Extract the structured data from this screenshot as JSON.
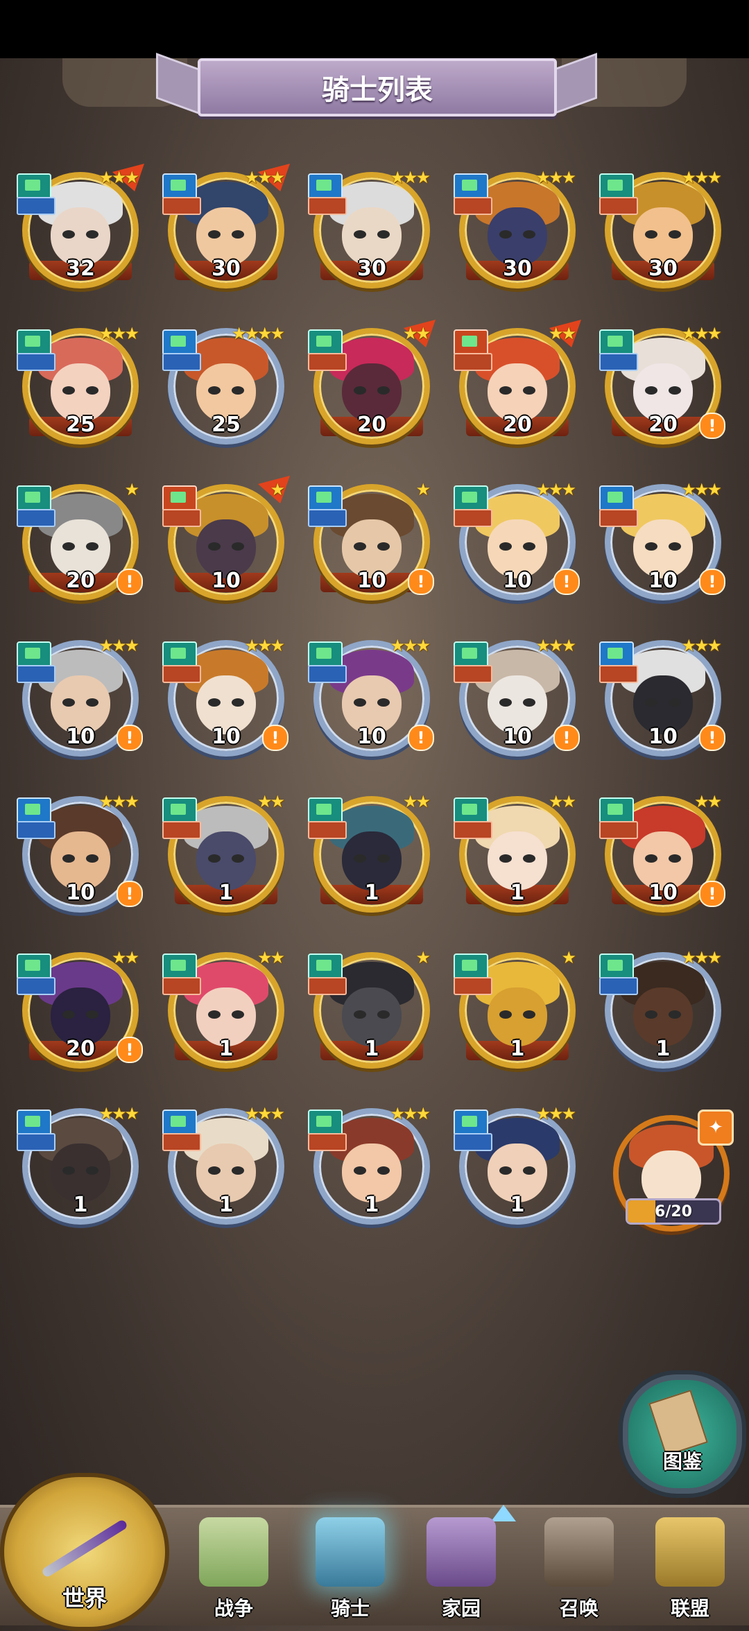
{
  "header": {
    "title": "骑士列表"
  },
  "knights": [
    {
      "level": "32",
      "stars": "★★★",
      "frame": "gold",
      "cls": "teal",
      "role": "blue",
      "flag": true,
      "warn": false,
      "skin": "#e9d6c8",
      "hair": "#e0e0e0"
    },
    {
      "level": "30",
      "stars": "★★★",
      "frame": "gold",
      "cls": "blue",
      "role": "red",
      "flag": true,
      "warn": false,
      "skin": "#f0c8a0",
      "hair": "#32456a"
    },
    {
      "level": "30",
      "stars": "★★★",
      "frame": "gold",
      "cls": "blue",
      "role": "red",
      "flag": false,
      "warn": false,
      "skin": "#ead8c6",
      "hair": "#dcdcdc"
    },
    {
      "level": "30",
      "stars": "★★★",
      "frame": "gold",
      "cls": "blue",
      "role": "red",
      "flag": false,
      "warn": false,
      "skin": "#3a3e6a",
      "hair": "#c8762a"
    },
    {
      "level": "30",
      "stars": "★★★",
      "frame": "gold",
      "cls": "teal",
      "role": "red",
      "flag": false,
      "warn": false,
      "skin": "#f2c08c",
      "hair": "#c8902a"
    },
    {
      "level": "25",
      "stars": "★★★",
      "frame": "gold",
      "cls": "teal",
      "role": "blue",
      "flag": false,
      "warn": false,
      "skin": "#f4d2c0",
      "hair": "#d86a5a"
    },
    {
      "level": "25",
      "stars": "★★★★",
      "frame": "blue",
      "cls": "blue",
      "role": "blue",
      "flag": false,
      "warn": false,
      "skin": "#f2c8a0",
      "hair": "#c8582a"
    },
    {
      "level": "20",
      "stars": "★★",
      "frame": "gold",
      "cls": "teal",
      "role": "red",
      "flag": true,
      "warn": false,
      "skin": "#5a2a3a",
      "hair": "#c82a5a"
    },
    {
      "level": "20",
      "stars": "★★",
      "frame": "gold",
      "cls": "red",
      "role": "red",
      "flag": true,
      "warn": false,
      "skin": "#f6d2b8",
      "hair": "#d8502a"
    },
    {
      "level": "20",
      "stars": "★★★",
      "frame": "gold",
      "cls": "teal",
      "role": "blue",
      "flag": false,
      "warn": true,
      "skin": "#f0e6e6",
      "hair": "#e8e0d8"
    },
    {
      "level": "20",
      "stars": "★",
      "frame": "gold",
      "cls": "teal",
      "role": "blue",
      "flag": false,
      "warn": true,
      "skin": "#e8e2d8",
      "hair": "#888"
    },
    {
      "level": "10",
      "stars": "★",
      "frame": "gold",
      "cls": "red",
      "role": "red",
      "flag": true,
      "warn": false,
      "skin": "#4a3a4a",
      "hair": "#c8902a"
    },
    {
      "level": "10",
      "stars": "★",
      "frame": "gold",
      "cls": "blue",
      "role": "blue",
      "flag": false,
      "warn": true,
      "skin": "#e6c8a8",
      "hair": "#6a4a30"
    },
    {
      "level": "10",
      "stars": "★★★",
      "frame": "blue",
      "cls": "teal",
      "role": "red",
      "flag": false,
      "warn": true,
      "skin": "#f6d8b8",
      "hair": "#f0c860"
    },
    {
      "level": "10",
      "stars": "★★★",
      "frame": "blue",
      "cls": "blue",
      "role": "red",
      "flag": false,
      "warn": true,
      "skin": "#f6dcc0",
      "hair": "#f0c860"
    },
    {
      "level": "10",
      "stars": "★★★",
      "frame": "blue",
      "cls": "teal",
      "role": "blue",
      "flag": false,
      "warn": true,
      "skin": "#e8cab0",
      "hair": "#bcbcbc"
    },
    {
      "level": "10",
      "stars": "★★★",
      "frame": "blue",
      "cls": "teal",
      "role": "red",
      "flag": false,
      "warn": true,
      "skin": "#f0e0d0",
      "hair": "#c87a2a"
    },
    {
      "level": "10",
      "stars": "★★★",
      "frame": "blue",
      "cls": "teal",
      "role": "blue",
      "flag": false,
      "warn": true,
      "skin": "#e8cab0",
      "hair": "#7a3a8a"
    },
    {
      "level": "10",
      "stars": "★★★",
      "frame": "blue",
      "cls": "teal",
      "role": "red",
      "flag": false,
      "warn": true,
      "skin": "#ece6e0",
      "hair": "#c8b8a8"
    },
    {
      "level": "10",
      "stars": "★★★",
      "frame": "blue",
      "cls": "blue",
      "role": "red",
      "flag": false,
      "warn": true,
      "skin": "#2a2a30",
      "hair": "#e0e0e0"
    },
    {
      "level": "10",
      "stars": "★★★",
      "frame": "blue",
      "cls": "blue",
      "role": "blue",
      "flag": false,
      "warn": true,
      "skin": "#e6b890",
      "hair": "#5a3a2a"
    },
    {
      "level": "1",
      "stars": "★★",
      "frame": "gold",
      "cls": "teal",
      "role": "red",
      "flag": false,
      "warn": false,
      "skin": "#4a4a6a",
      "hair": "#bcbcbc"
    },
    {
      "level": "1",
      "stars": "★★",
      "frame": "gold",
      "cls": "teal",
      "role": "red",
      "flag": false,
      "warn": false,
      "skin": "#2a2a3a",
      "hair": "#3a6a7a"
    },
    {
      "level": "1",
      "stars": "★★",
      "frame": "gold",
      "cls": "teal",
      "role": "red",
      "flag": false,
      "warn": false,
      "skin": "#f6e0d0",
      "hair": "#f0d8b0"
    },
    {
      "level": "10",
      "stars": "★★",
      "frame": "gold",
      "cls": "teal",
      "role": "red",
      "flag": false,
      "warn": true,
      "skin": "#f2c8a8",
      "hair": "#c83a2a"
    },
    {
      "level": "20",
      "stars": "★★",
      "frame": "gold",
      "cls": "teal",
      "role": "blue",
      "flag": false,
      "warn": true,
      "skin": "#2a2240",
      "hair": "#6a3a8a"
    },
    {
      "level": "1",
      "stars": "★★",
      "frame": "gold",
      "cls": "teal",
      "role": "red",
      "flag": false,
      "warn": false,
      "skin": "#f2d0c0",
      "hair": "#e04a6a"
    },
    {
      "level": "1",
      "stars": "★",
      "frame": "gold",
      "cls": "teal",
      "role": "red",
      "flag": false,
      "warn": false,
      "skin": "#4a4a50",
      "hair": "#2a2a30"
    },
    {
      "level": "1",
      "stars": "★",
      "frame": "gold",
      "cls": "teal",
      "role": "red",
      "flag": false,
      "warn": false,
      "skin": "#d8a030",
      "hair": "#e8b83a"
    },
    {
      "level": "1",
      "stars": "★★★",
      "frame": "blue",
      "cls": "teal",
      "role": "blue",
      "flag": false,
      "warn": false,
      "skin": "#5a3a2a",
      "hair": "#3a2a20"
    },
    {
      "level": "1",
      "stars": "★★★",
      "frame": "blue",
      "cls": "blue",
      "role": "blue",
      "flag": false,
      "warn": false,
      "skin": "#3a3030",
      "hair": "#5a4a40"
    },
    {
      "level": "1",
      "stars": "★★★",
      "frame": "blue",
      "cls": "blue",
      "role": "red",
      "flag": false,
      "warn": false,
      "skin": "#e8cab0",
      "hair": "#e8dcc8"
    },
    {
      "level": "1",
      "stars": "★★★",
      "frame": "blue",
      "cls": "teal",
      "role": "red",
      "flag": false,
      "warn": false,
      "skin": "#f2c8a8",
      "hair": "#8a3a2a"
    },
    {
      "level": "1",
      "stars": "★★★",
      "frame": "blue",
      "cls": "blue",
      "role": "blue",
      "flag": false,
      "warn": false,
      "skin": "#f0d0b8",
      "hair": "#2a3a6a"
    }
  ],
  "shard": {
    "progress_text": "6/20",
    "progress_fraction": 0.3
  },
  "codex": {
    "label": "图鉴"
  },
  "nav": {
    "world": "世界",
    "battle": "战争",
    "knights": "骑士",
    "home": "家园",
    "summon": "召唤",
    "alliance": "联盟"
  }
}
